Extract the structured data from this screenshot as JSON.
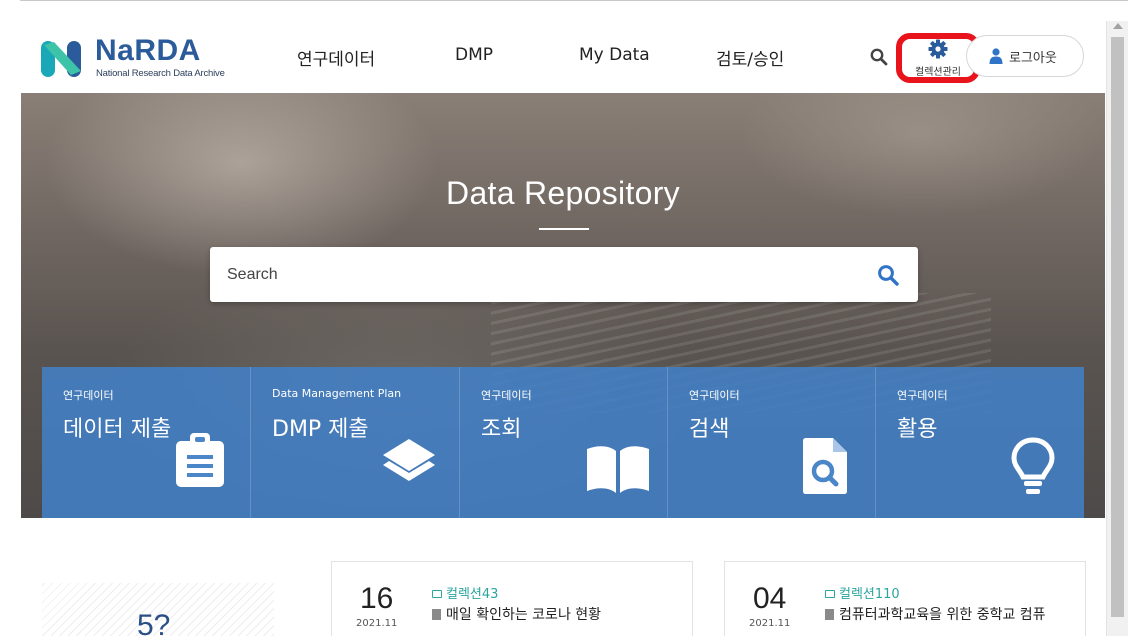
{
  "header": {
    "logo_name": "NaRDA",
    "logo_subtitle": "National Research Data Archive",
    "nav": [
      "연구데이터",
      "DMP",
      "My Data",
      "검토/승인"
    ],
    "collection_manage_label": "컬렉션관리",
    "logout_label": "로그아웃"
  },
  "hero": {
    "title": "Data Repository",
    "search_placeholder": "Search"
  },
  "tiles": [
    {
      "category": "연구데이터",
      "title": "데이터 제출",
      "icon": "clipboard-icon"
    },
    {
      "category": "Data Management Plan",
      "title": "DMP 제출",
      "icon": "layers-icon"
    },
    {
      "category": "연구데이터",
      "title": "조회",
      "icon": "open-book-icon"
    },
    {
      "category": "연구데이터",
      "title": "검색",
      "icon": "search-document-icon"
    },
    {
      "category": "연구데이터",
      "title": "활용",
      "icon": "lightbulb-icon"
    }
  ],
  "stats": {
    "value": "5?"
  },
  "cards": [
    {
      "day": "16",
      "year_month": "2021.11",
      "collection": "컬렉션43",
      "title": "매일 확인하는 코로나 현황"
    },
    {
      "day": "04",
      "year_month": "2021.11",
      "collection": "컬렉션110",
      "title": "컴퓨터과학교육을 위한 중학교 컴퓨"
    }
  ],
  "colors": {
    "brand_blue": "#2b5b9b",
    "tile_blue": "#4280c6",
    "highlight_red": "#e8131b",
    "collection_teal": "#2ca5a0"
  }
}
